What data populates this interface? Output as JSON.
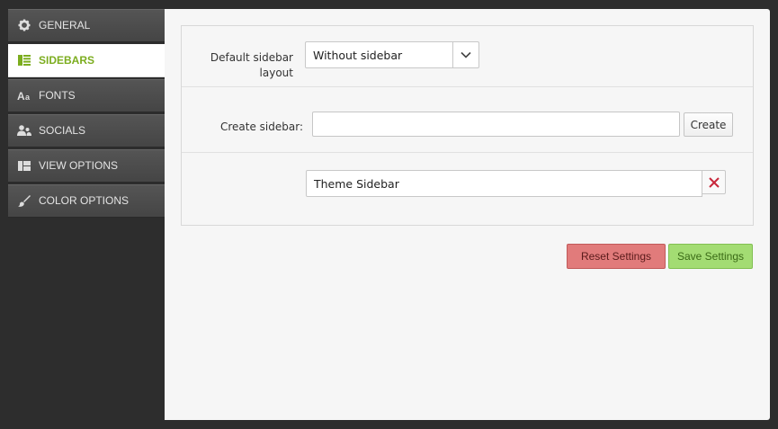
{
  "nav": {
    "items": [
      {
        "label": "GENERAL",
        "icon": "gear-icon"
      },
      {
        "label": "SIDEBARS",
        "icon": "sidebar-layout-icon",
        "active": true
      },
      {
        "label": "FONTS",
        "icon": "font-icon"
      },
      {
        "label": "SOCIALS",
        "icon": "users-icon"
      },
      {
        "label": "VIEW OPTIONS",
        "icon": "view-grid-icon"
      },
      {
        "label": "COLOR OPTIONS",
        "icon": "brush-icon"
      }
    ]
  },
  "form": {
    "default_layout_label": "Default sidebar layout",
    "default_layout_value": "Without sidebar",
    "create_sidebar_label": "Create sidebar:",
    "create_sidebar_value": "",
    "create_button": "Create",
    "sidebars": [
      {
        "name": "Theme Sidebar"
      }
    ]
  },
  "actions": {
    "reset": "Reset Settings",
    "save": "Save Settings"
  },
  "colors": {
    "active_nav_text": "#7cad1f",
    "reset_button": "#e17b7b",
    "save_button": "#a3dc73",
    "delete_x": "#c8283c"
  }
}
